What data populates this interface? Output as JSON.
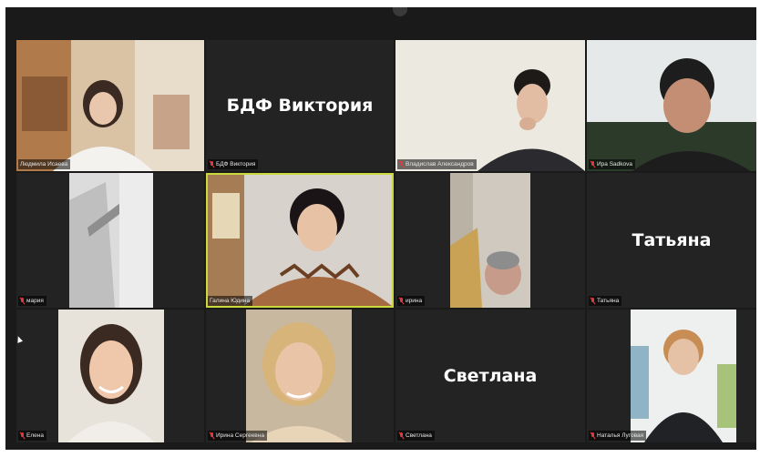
{
  "participants": [
    {
      "id": 1,
      "label": "Людмила Исаева",
      "mic_muted": false
    },
    {
      "id": 2,
      "label": "БДФ Виктория",
      "display_name": "БДФ Виктория",
      "mic_muted": true
    },
    {
      "id": 3,
      "label": "Владислав Александров",
      "mic_muted": true
    },
    {
      "id": 4,
      "label": "Ира Sadkova",
      "mic_muted": true
    },
    {
      "id": 5,
      "label": "мария",
      "mic_muted": true
    },
    {
      "id": 6,
      "label": "Галина Юдина",
      "mic_muted": false,
      "active_speaker": true
    },
    {
      "id": 7,
      "label": "ирина",
      "mic_muted": true
    },
    {
      "id": 8,
      "label": "Татьяна",
      "display_name": "Татьяна",
      "mic_muted": true
    },
    {
      "id": 9,
      "label": "Елена",
      "mic_muted": true
    },
    {
      "id": 10,
      "label": "Ирина Сергеевна",
      "mic_muted": true
    },
    {
      "id": 11,
      "label": "Светлана",
      "display_name": "Светлана",
      "mic_muted": true
    },
    {
      "id": 12,
      "label": "Наталья Луговая",
      "mic_muted": true
    }
  ],
  "colors": {
    "background": "#1a1a1a",
    "tile": "#232323",
    "active_speaker_border": "#c9d83a",
    "muted_mic": "#e23b3b"
  },
  "icons": [
    "mic-muted-icon",
    "mouse-pointer-icon"
  ]
}
